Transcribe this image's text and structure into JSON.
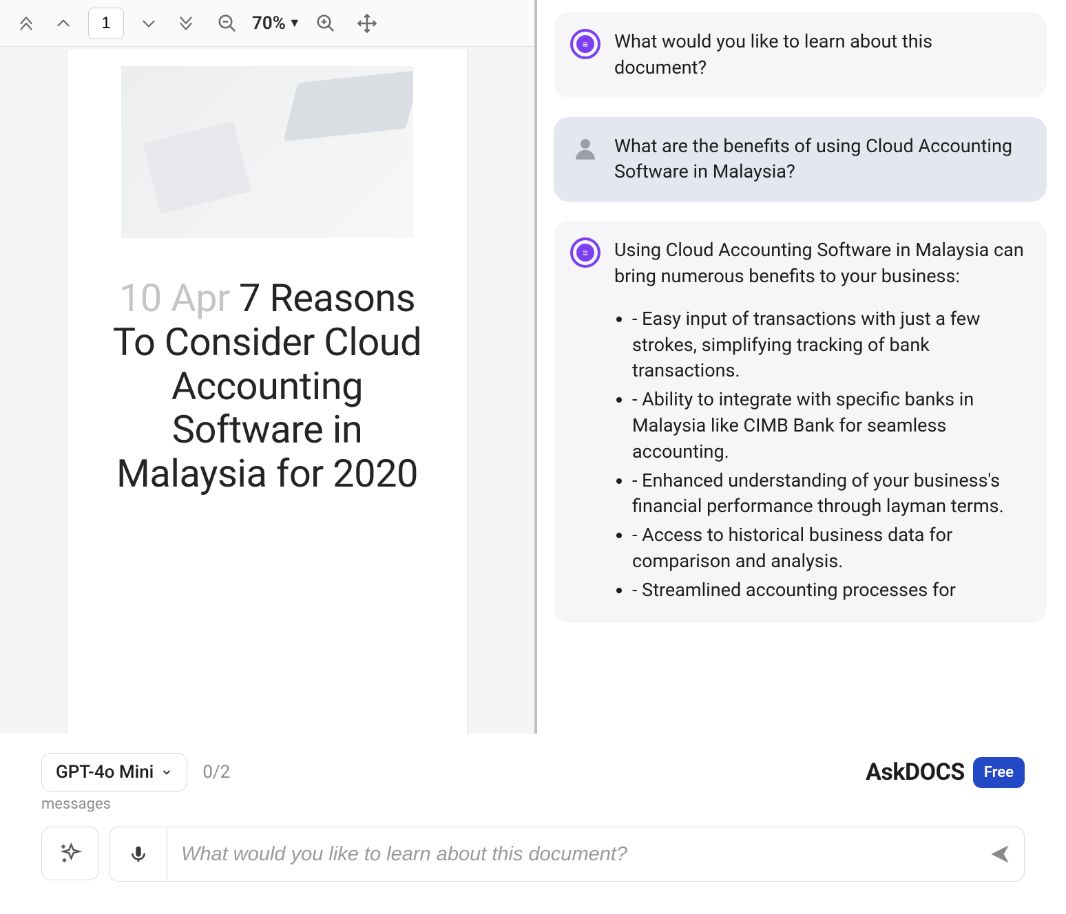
{
  "toolbar": {
    "page_number": "1",
    "zoom_label": "70%"
  },
  "document": {
    "date": "10 Apr",
    "title": "7 Reasons To Consider Cloud Accounting Software in Malaysia for 2020"
  },
  "chat": {
    "intro": "What would you like to learn about this document?",
    "user_q": "What are the benefits of using Cloud Accounting Software in Malaysia?",
    "answer_lead": "Using Cloud Accounting Software in Malaysia can bring numerous benefits to your business:",
    "bullets": [
      "- Easy input of transactions with just a few strokes, simplifying tracking of bank transactions.",
      "- Ability to integrate with specific banks in Malaysia like CIMB Bank for seamless accounting.",
      "- Enhanced understanding of your business's financial performance through layman terms.",
      "- Access to historical business data for comparison and analysis.",
      "- Streamlined accounting processes for"
    ]
  },
  "footer": {
    "model": "GPT-4o Mini",
    "count": "0/2",
    "messages_label": "messages",
    "brand": "AskDOCS",
    "badge": "Free",
    "placeholder": "What would you like to learn about this document?"
  }
}
